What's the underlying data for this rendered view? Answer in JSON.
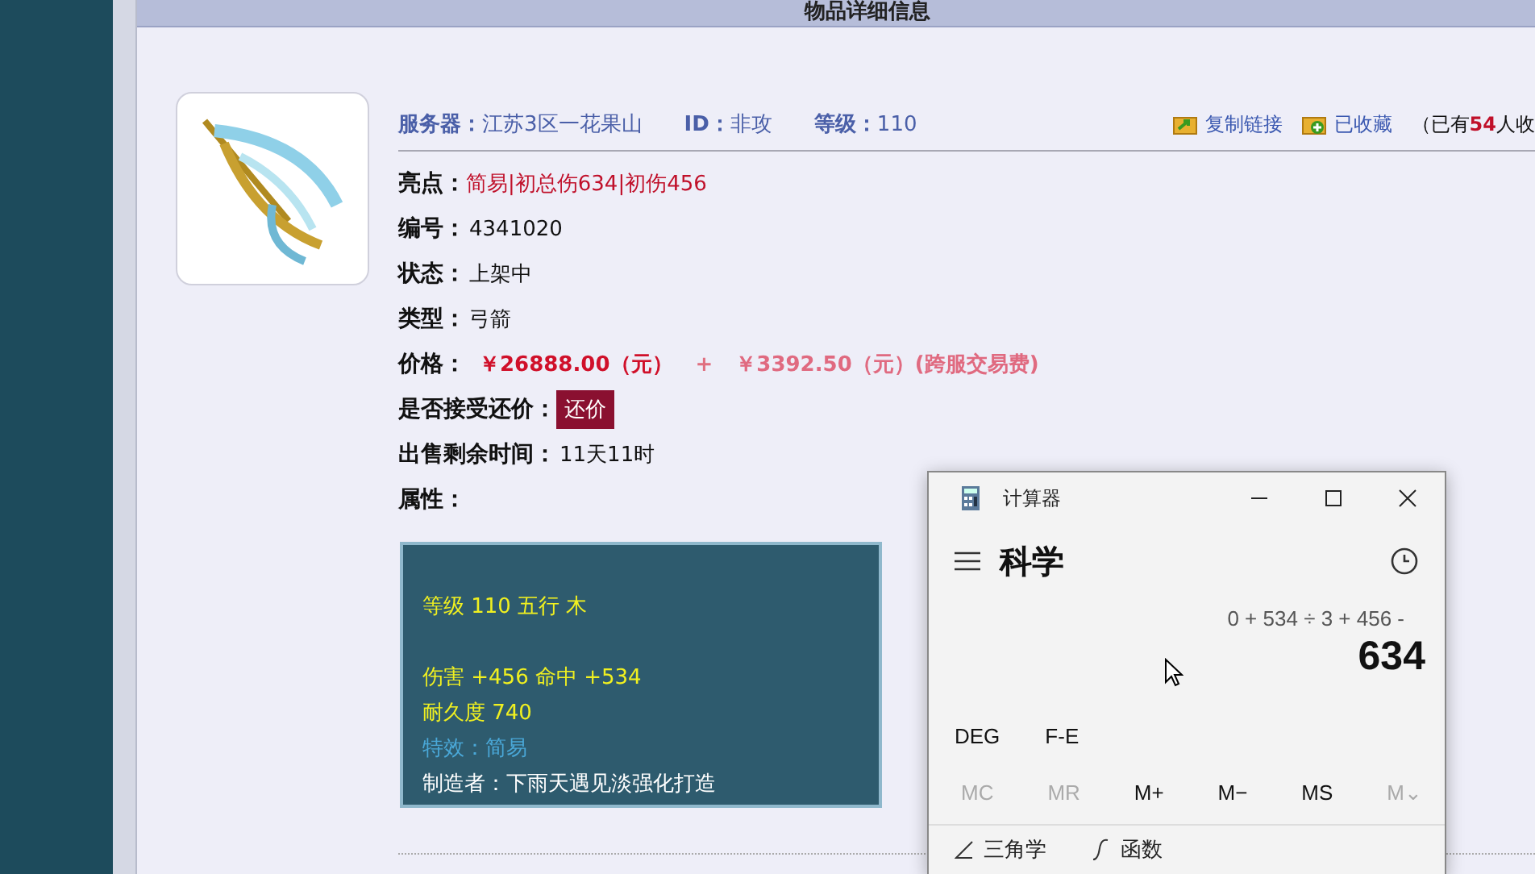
{
  "header": {
    "title": "物品详细信息"
  },
  "item": {
    "server": {
      "label": "服务器：",
      "value": "江苏3区一花果山"
    },
    "id": {
      "label": "ID：",
      "value": "非攻"
    },
    "level": {
      "label": "等级：",
      "value": "110"
    },
    "actions": [
      {
        "kind": "copy",
        "label": "复制链接"
      },
      {
        "kind": "favorite",
        "label": "已收藏"
      }
    ],
    "favorites_note": {
      "prefix": "（已有",
      "count": "54",
      "suffix": "人收"
    },
    "fields": [
      {
        "kind": "highlight",
        "label": "亮点：",
        "parts": [
          "简易",
          "初总伤634",
          "初伤456"
        ],
        "separator": "|"
      },
      {
        "kind": "text",
        "label": "编号：",
        "value": "4341020"
      },
      {
        "kind": "text",
        "label": "状态：",
        "value": "上架中"
      },
      {
        "kind": "text",
        "label": "类型：",
        "value": "弓箭"
      },
      {
        "kind": "price",
        "label": "价格：",
        "price": "￥26888.00（元）",
        "plus": "+",
        "fee": "￥3392.50（元）(跨服交易费)"
      },
      {
        "kind": "button",
        "label": "是否接受还价：",
        "value": "还价"
      },
      {
        "kind": "text",
        "label": "出售剩余时间：",
        "value": "11天11时"
      },
      {
        "kind": "text",
        "label": "属性："
      }
    ],
    "attributes": [
      {
        "kind": "stat",
        "text": "等级 110 五行 木"
      },
      {
        "kind": "blank"
      },
      {
        "kind": "stat",
        "text": "伤害 +456 命中 +534"
      },
      {
        "kind": "stat",
        "text": "耐久度 740"
      },
      {
        "kind": "effect",
        "text": "特效：简易"
      },
      {
        "kind": "maker",
        "text": "制造者：下雨天遇见淡强化打造"
      }
    ]
  },
  "calculator": {
    "title": "计算器",
    "mode": "科学",
    "expression": "0 + 534 ÷ 3 + 456 -",
    "result": "634",
    "toggles": [
      "DEG",
      "F-E"
    ],
    "memory": [
      {
        "label": "MC",
        "disabled": true
      },
      {
        "label": "MR",
        "disabled": true
      },
      {
        "label": "M+",
        "disabled": false
      },
      {
        "label": "M−",
        "disabled": false
      },
      {
        "label": "MS",
        "disabled": false
      },
      {
        "label": "M⌄",
        "disabled": true
      }
    ],
    "menus": [
      {
        "kind": "trig",
        "label": "三角学"
      },
      {
        "kind": "func",
        "label": "函数"
      }
    ]
  }
}
